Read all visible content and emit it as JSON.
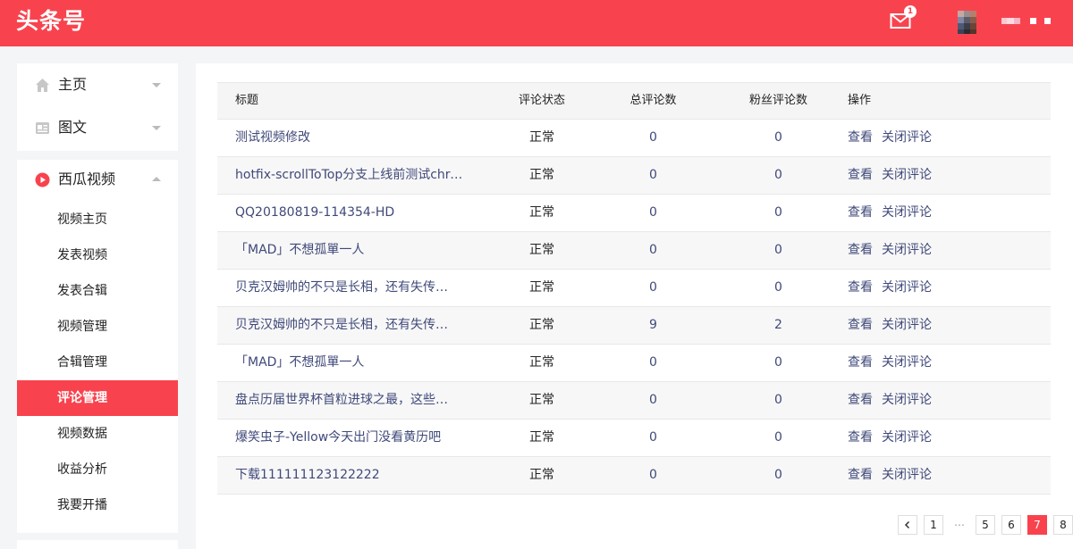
{
  "header": {
    "logo": "头条号",
    "mail_badge": "1",
    "brand_color": "#f8434e"
  },
  "sidebar": {
    "home_label": "主页",
    "article_label": "图文",
    "video_label": "西瓜视频",
    "video_sub": [
      "视频主页",
      "发表视频",
      "发表合辑",
      "视频管理",
      "合辑管理",
      "评论管理",
      "视频数据",
      "收益分析",
      "我要开播"
    ],
    "active_sub": "评论管理"
  },
  "table": {
    "headers": {
      "title": "标题",
      "status": "评论状态",
      "total": "总评论数",
      "fans": "粉丝评论数",
      "ops": "操作"
    },
    "rows": [
      {
        "title": "测试视频修改",
        "status": "正常",
        "total": "0",
        "fans": "0",
        "view": "查看",
        "close": "关闭评论"
      },
      {
        "title": "hotfix-scrollToTop分支上线前测试chro…",
        "status": "正常",
        "total": "0",
        "fans": "0",
        "view": "查看",
        "close": "关闭评论"
      },
      {
        "title": "QQ20180819-114354-HD",
        "status": "正常",
        "total": "0",
        "fans": "0",
        "view": "查看",
        "close": "关闭评论"
      },
      {
        "title": "「MAD」不想孤單一人",
        "status": "正常",
        "total": "0",
        "fans": "0",
        "view": "查看",
        "close": "关闭评论"
      },
      {
        "title": "贝克汉姆帅的不只是长相，还有失传…",
        "status": "正常",
        "total": "0",
        "fans": "0",
        "view": "查看",
        "close": "关闭评论"
      },
      {
        "title": "贝克汉姆帅的不只是长相，还有失传…",
        "status": "正常",
        "total": "9",
        "fans": "2",
        "view": "查看",
        "close": "关闭评论"
      },
      {
        "title": "「MAD」不想孤單一人",
        "status": "正常",
        "total": "0",
        "fans": "0",
        "view": "查看",
        "close": "关闭评论"
      },
      {
        "title": "盘点历届世界杯首粒进球之最，这些…",
        "status": "正常",
        "total": "0",
        "fans": "0",
        "view": "查看",
        "close": "关闭评论"
      },
      {
        "title": "爆笑虫子-Yellow今天出门没看黄历吧",
        "status": "正常",
        "total": "0",
        "fans": "0",
        "view": "查看",
        "close": "关闭评论"
      },
      {
        "title": "下载111111123122222",
        "status": "正常",
        "total": "0",
        "fans": "0",
        "view": "查看",
        "close": "关闭评论"
      }
    ]
  },
  "pagination": {
    "prev_icon": "chevron-left-icon",
    "pages": [
      "1",
      "…",
      "5",
      "6",
      "7",
      "8"
    ],
    "current": "7"
  }
}
